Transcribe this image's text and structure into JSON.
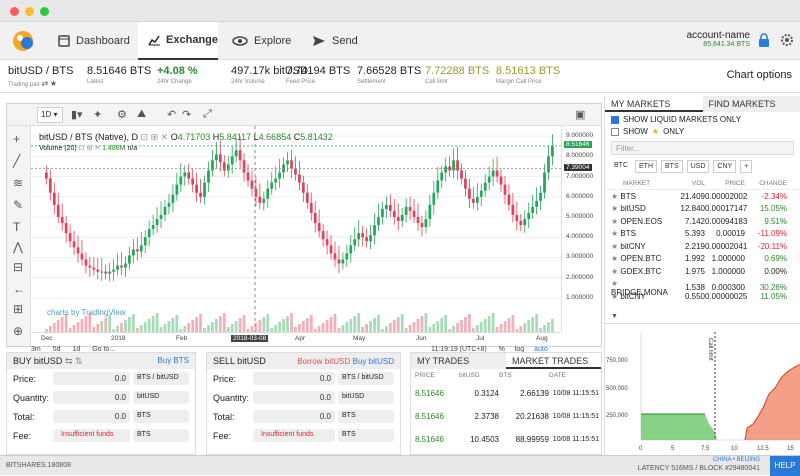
{
  "nav": {
    "dashboard": "Dashboard",
    "exchange": "Exchange",
    "explore": "Explore",
    "send": "Send"
  },
  "account": {
    "name": "account-name",
    "balance": "85,641.34 BTS"
  },
  "pair": {
    "label": "bitUSD / BTS",
    "sub": "Trading pair"
  },
  "stats": [
    {
      "value": "8.51646 BTS",
      "label": "Latest"
    },
    {
      "value": "+4.08 %",
      "label": "24hr Change",
      "color": "#2a8a2a"
    },
    {
      "value": "497.17k bitUSD",
      "label": "24hr Volume"
    },
    {
      "value": "7.74194 BTS",
      "label": "Feed Price"
    },
    {
      "value": "7.66528 BTS",
      "label": "Settlement"
    },
    {
      "value": "7.72288 BTS",
      "label": "Call limit",
      "color": "#9a9a2a"
    },
    {
      "value": "8.51613 BTS",
      "label": "Margin Call Price",
      "color": "#9a9a2a"
    }
  ],
  "chart_options": "Chart options",
  "chart_toolbar": {
    "interval": "1D"
  },
  "chart_legend": {
    "title": "bitUSD / BTS (Native), D",
    "o": "O",
    "o_val": "4.71703",
    "h": "H",
    "h_val": "5.84117",
    "l": "L",
    "l_val": "4.66854",
    "c": "C",
    "c_val": "5.81432",
    "volume": "Volume (20)",
    "volume_val": "1.486M",
    "volume_na": "n/a"
  },
  "chart_watermark": "charts by TradingView",
  "chart_bottom": {
    "ranges": [
      "3m",
      "5d",
      "1d",
      "Go to..."
    ],
    "time": "11:19:19 (UTC+8)",
    "opts": [
      "%",
      "log",
      "auto"
    ]
  },
  "chart_data": {
    "type": "candlestick",
    "x_ticks": [
      "Dec",
      "2018",
      "Feb",
      "2018-03-08",
      "Apr",
      "May",
      "Jun",
      "Jul",
      "Aug"
    ],
    "y_ticks": [
      9.0,
      8.0,
      7.0,
      6.0,
      5.0,
      4.0,
      3.0,
      2.0,
      1.0
    ],
    "ylim": [
      0.6,
      9.3
    ],
    "last_price_tag": "8.51646",
    "feed_tag": "7.39004",
    "closes": [
      6.9,
      6.2,
      5.6,
      5.0,
      4.7,
      4.2,
      3.8,
      3.5,
      3.2,
      2.9,
      2.6,
      2.5,
      2.4,
      2.3,
      2.3,
      2.2,
      2.3,
      2.4,
      2.6,
      2.5,
      2.7,
      3.1,
      3.4,
      3.3,
      3.6,
      4.0,
      4.4,
      4.6,
      4.9,
      5.1,
      5.5,
      5.7,
      6.1,
      6.6,
      7.0,
      7.2,
      6.9,
      6.6,
      6.2,
      6.0,
      6.7,
      7.3,
      7.8,
      8.1,
      7.7,
      7.3,
      7.6,
      8.0,
      8.3,
      7.8,
      7.2,
      6.8,
      6.4,
      6.0,
      5.7,
      5.9,
      6.4,
      6.7,
      6.9,
      7.2,
      7.6,
      7.8,
      7.4,
      7.1,
      6.7,
      6.2,
      5.7,
      5.2,
      4.7,
      4.3,
      3.9,
      3.6,
      3.2,
      2.9,
      2.7,
      2.9,
      3.2,
      3.6,
      3.9,
      4.2,
      4.0,
      3.8,
      4.1,
      4.6,
      5.0,
      5.4,
      5.6,
      5.3,
      5.0,
      4.8,
      5.1,
      5.5,
      5.3,
      5.0,
      4.7,
      4.5,
      4.9,
      5.6,
      6.2,
      6.8,
      7.2,
      7.5,
      7.3,
      7.8,
      7.3,
      6.9,
      6.4,
      5.9,
      5.7,
      6.0,
      6.3,
      6.7,
      7.0,
      7.3,
      7.0,
      6.6,
      6.1,
      5.6,
      5.1,
      4.8,
      4.6,
      4.9,
      5.2,
      5.5,
      5.8,
      6.2,
      7.2,
      8.0,
      8.5
    ]
  },
  "my_markets": {
    "tab_my": "MY MARKETS",
    "tab_find": "FIND MARKETS",
    "show_liquid": "SHOW LIQUID MARKETS ONLY",
    "show_star": "SHOW",
    "show_star_only": "ONLY",
    "filter_placeholder": "Filter...",
    "currencies": [
      "BTC",
      "ETH",
      "BTS",
      "USD",
      "CNY",
      "+"
    ],
    "headers": [
      "MARKET",
      "VOL",
      "PRICE",
      "CHANGE"
    ],
    "rows": [
      {
        "market": "BTS",
        "vol": "21.409",
        "price": "0.00002002",
        "change": "-2.34%",
        "dir": "neg"
      },
      {
        "market": "bitUSD",
        "vol": "12.840",
        "price": "0.00017147",
        "change": "15.05%",
        "dir": "pos"
      },
      {
        "market": "OPEN.EOS",
        "vol": "7.142",
        "price": "0.00094183",
        "change": "9.51%",
        "dir": "pos"
      },
      {
        "market": "BTS",
        "vol": "5.393",
        "price": "0.00019",
        "change": "-11.09%",
        "dir": "neg"
      },
      {
        "market": "bitCNY",
        "vol": "2.219",
        "price": "0.00002041",
        "change": "-20.11%",
        "dir": "neg"
      },
      {
        "market": "OPEN.BTC",
        "vol": "1.992",
        "price": "1.000000",
        "change": "0.69%",
        "dir": "pos"
      },
      {
        "market": "GDEX.BTC",
        "vol": "1.975",
        "price": "1.000000",
        "change": "0.00%",
        "dir": "zero"
      },
      {
        "market": "BRIDGE.MONA",
        "vol": "1.538",
        "price": "0.000300",
        "change": "30.26%",
        "dir": "pos"
      },
      {
        "market": "bitCNY",
        "vol": "0.550",
        "price": "0.00000025",
        "change": "11.05%",
        "dir": "pos"
      }
    ]
  },
  "depth": {
    "y_ticks": [
      "750,000",
      "500,000",
      "250,000"
    ],
    "x_ticks": [
      "0",
      "5",
      "7.5",
      "10",
      "12.5",
      "15"
    ],
    "call_limit_label": "Call limit"
  },
  "buy": {
    "title": "BUY bitUSD",
    "link": "Buy BTS",
    "price_label": "Price:",
    "price_val": "0.0",
    "price_unit": "BTS / bitUSD",
    "qty_label": "Quantity:",
    "qty_val": "0.0",
    "qty_unit": "bitUSD",
    "total_label": "Total:",
    "total_val": "0.0",
    "total_unit": "BTS",
    "fee_label": "Fee:",
    "fee_val": "Insufficient funds",
    "fee_unit": "BTS"
  },
  "sell": {
    "title": "SELL bitUSD",
    "link1": "Borrow bitUSD",
    "link2": "Buy bitUSD",
    "price_label": "Price:",
    "price_val": "0.0",
    "price_unit": "BTS / bitUSD",
    "qty_label": "Quantity:",
    "qty_val": "0.0",
    "qty_unit": "bitUSD",
    "total_label": "Total:",
    "total_val": "0.0",
    "total_unit": "BTS",
    "fee_label": "Fee:",
    "fee_val": "Insufficient funds",
    "fee_unit": "BTS"
  },
  "trades": {
    "tab_my": "MY TRADES",
    "tab_market": "MARKET TRADES",
    "headers": [
      "PRICE",
      "bitUSD",
      "BTS",
      "DATE"
    ],
    "rows": [
      {
        "price": "8.51646",
        "usd": "0.3124",
        "bts": "2.66139",
        "date": "10/08 11:15:51"
      },
      {
        "price": "8.51646",
        "usd": "2.3738",
        "bts": "20.21638",
        "date": "10/08 11:15:51"
      },
      {
        "price": "8.51646",
        "usd": "10.4503",
        "bts": "88.99959",
        "date": "10/08 11:15:51"
      }
    ]
  },
  "footer": {
    "version": "BITSHARES.180808",
    "location": "CHINA • BEIJING",
    "latency": "LATENCY 516MS / BLOCK #29480041",
    "help": "HELP"
  }
}
